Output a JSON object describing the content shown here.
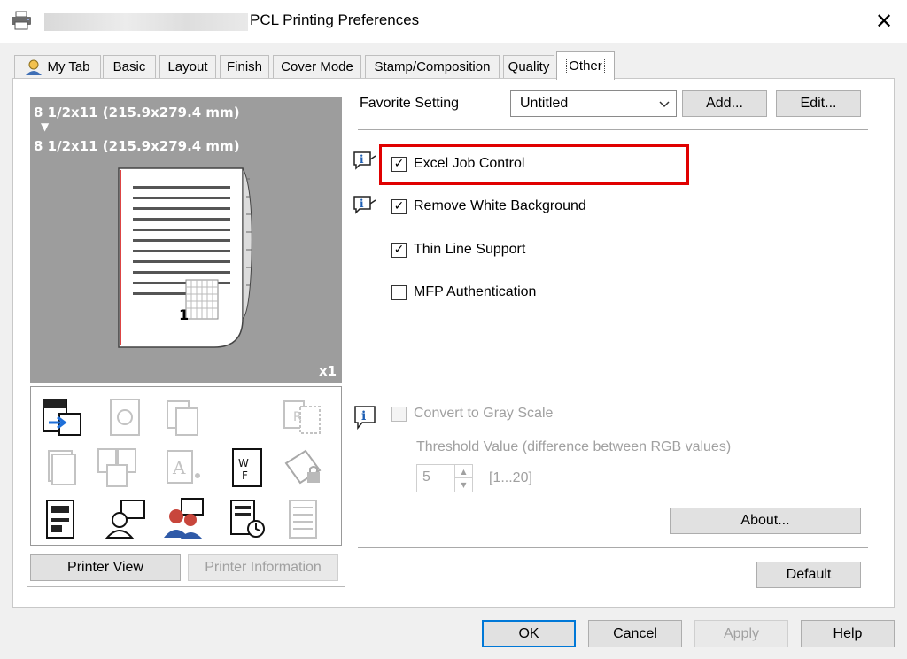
{
  "window": {
    "title": "PCL Printing Preferences",
    "close_glyph": "✕"
  },
  "tabs": [
    {
      "label": "My Tab",
      "icon": "user-icon"
    },
    {
      "label": "Basic"
    },
    {
      "label": "Layout"
    },
    {
      "label": "Finish"
    },
    {
      "label": "Cover Mode"
    },
    {
      "label": "Stamp/Composition"
    },
    {
      "label": "Quality"
    },
    {
      "label": "Other",
      "active": true
    }
  ],
  "preview": {
    "original_size": "8 1/2x11 (215.9x279.4 mm)",
    "arrow": "▼",
    "output_size": "8 1/2x11 (215.9x279.4 mm)",
    "page_number": "1",
    "copies": "x1"
  },
  "left_buttons": {
    "printer_view": "Printer View",
    "printer_view_key": "V",
    "printer_information": "Printer Information",
    "printer_information_key": "I"
  },
  "favorite": {
    "label": "Favorite Setting",
    "key": "F",
    "value": "Untitled",
    "add_label": "Add...",
    "add_key": "d",
    "edit_label": "Edit...",
    "edit_key": "E"
  },
  "options": [
    {
      "label": "Excel Job Control",
      "key": "J",
      "checked": true,
      "info_icon": true
    },
    {
      "label": "Remove White Background",
      "key": "B",
      "checked": true,
      "info_icon": true
    },
    {
      "label": "Thin Line Support",
      "key": "S",
      "checked": true
    },
    {
      "label": "MFP Authentication",
      "key": "u",
      "checked": false
    }
  ],
  "gray_scale": {
    "label": "Convert to Gray Scale",
    "key": "G",
    "checked": false,
    "disabled": true,
    "threshold_label": "Threshold Value (difference between RGB values)",
    "threshold_value": "5",
    "range": "[1...20]"
  },
  "buttons": {
    "about": "About...",
    "default": "Default",
    "ok": "OK",
    "cancel": "Cancel",
    "apply": "Apply",
    "help": "Help"
  },
  "colors": {
    "highlight": "#e00000",
    "focus_border": "#0078d7",
    "preview_bg": "#9d9d9d"
  }
}
